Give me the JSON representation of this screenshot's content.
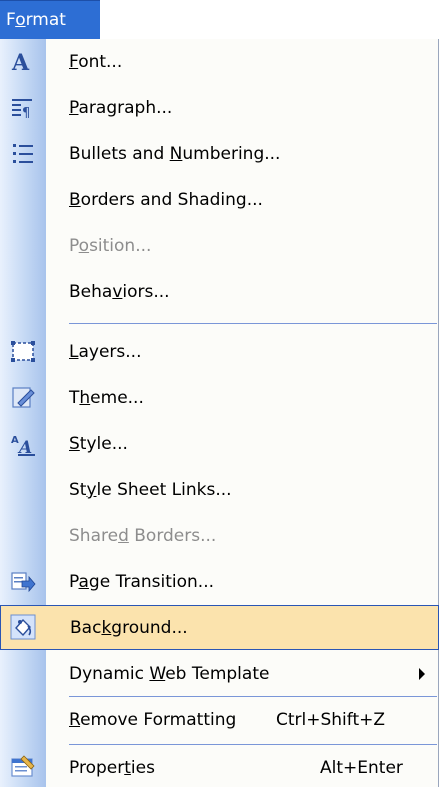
{
  "menubar": {
    "active_menu": "Format",
    "active_menu_display": "Format"
  },
  "menu": {
    "items": [
      {
        "id": "font",
        "before": "",
        "mnemonic": "F",
        "after": "ont...",
        "shortcut": "",
        "disabled": false,
        "icon": "font-icon"
      },
      {
        "id": "paragraph",
        "before": "",
        "mnemonic": "P",
        "after": "aragraph...",
        "shortcut": "",
        "disabled": false,
        "icon": "paragraph-icon"
      },
      {
        "id": "bullets-numbering",
        "before": "Bullets and ",
        "mnemonic": "N",
        "after": "umbering...",
        "shortcut": "",
        "disabled": false,
        "icon": "bullets-icon"
      },
      {
        "id": "borders-shading",
        "before": "",
        "mnemonic": "B",
        "after": "orders and Shading...",
        "shortcut": "",
        "disabled": false,
        "icon": ""
      },
      {
        "id": "position",
        "before": "P",
        "mnemonic": "o",
        "after": "sition...",
        "shortcut": "",
        "disabled": true,
        "icon": ""
      },
      {
        "id": "behaviors",
        "before": "Beha",
        "mnemonic": "v",
        "after": "iors...",
        "shortcut": "",
        "disabled": false,
        "icon": ""
      },
      {
        "id": "layers",
        "before": "",
        "mnemonic": "L",
        "after": "ayers...",
        "shortcut": "",
        "disabled": false,
        "icon": "layers-icon"
      },
      {
        "id": "theme",
        "before": "T",
        "mnemonic": "h",
        "after": "eme...",
        "shortcut": "",
        "disabled": false,
        "icon": "theme-icon"
      },
      {
        "id": "style",
        "before": "",
        "mnemonic": "S",
        "after": "tyle...",
        "shortcut": "",
        "disabled": false,
        "icon": "style-icon"
      },
      {
        "id": "style-sheet-links",
        "before": "St",
        "mnemonic": "y",
        "after": "le Sheet Links...",
        "shortcut": "",
        "disabled": false,
        "icon": ""
      },
      {
        "id": "shared-borders",
        "before": "Share",
        "mnemonic": "d",
        "after": " Borders...",
        "shortcut": "",
        "disabled": true,
        "icon": ""
      },
      {
        "id": "page-transition",
        "before": "P",
        "mnemonic": "a",
        "after": "ge Transition...",
        "shortcut": "",
        "disabled": false,
        "icon": "page-transition-icon"
      },
      {
        "id": "background",
        "before": "Bac",
        "mnemonic": "k",
        "after": "ground...",
        "shortcut": "",
        "disabled": false,
        "icon": "background-icon"
      },
      {
        "id": "dynamic-web-template",
        "before": "Dynamic ",
        "mnemonic": "W",
        "after": "eb Template",
        "shortcut": "",
        "disabled": false,
        "icon": ""
      },
      {
        "id": "remove-formatting",
        "before": "",
        "mnemonic": "R",
        "after": "emove Formatting",
        "shortcut": "Ctrl+Shift+Z",
        "disabled": false,
        "icon": ""
      },
      {
        "id": "properties",
        "before": "Proper",
        "mnemonic": "t",
        "after": "ies",
        "shortcut": "Alt+Enter",
        "disabled": false,
        "icon": "properties-icon"
      }
    ],
    "highlighted_item": "Background..."
  },
  "colors": {
    "menubar_active": "#2d6ed4",
    "highlight_fill": "#fbe3ad",
    "highlight_border": "#2a56b4",
    "disabled_text": "#8d8d8d"
  }
}
